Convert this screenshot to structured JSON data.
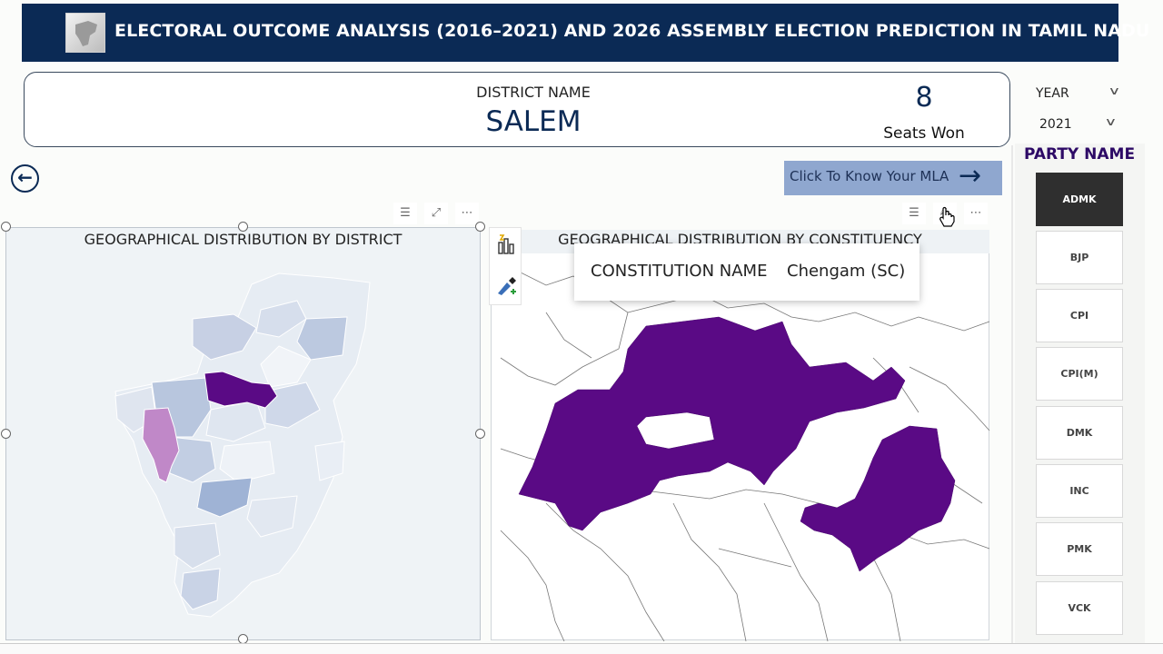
{
  "header": {
    "title": "ELECTORAL OUTCOME ANALYSIS (2016–2021) AND 2026 ASSEMBLY ELECTION PREDICTION IN TAMIL NADU"
  },
  "info_card": {
    "district_label": "DISTRICT NAME",
    "district_value": "SALEM",
    "seats_value": "8",
    "seats_label": "Seats Won"
  },
  "slicers": {
    "year_label": "YEAR",
    "year_value": "2021"
  },
  "party_panel": {
    "title": "PARTY NAME",
    "parties": [
      "ADMK",
      "BJP",
      "CPI",
      "CPI(M)",
      "DMK",
      "INC",
      "PMK",
      "VCK"
    ],
    "selected": "ADMK"
  },
  "mla_button": {
    "label": "Click To Know Your MLA"
  },
  "left_visual": {
    "title": "GEOGRAPHICAL DISTRIBUTION BY DISTRICT"
  },
  "right_visual": {
    "title": "GEOGRAPHICAL DISTRIBUTION BY CONSTITUENCY"
  },
  "tooltip": {
    "key": "CONSTITUTION NAME",
    "value": "Chengam (SC)"
  },
  "colors": {
    "header_bg": "#0b2a55",
    "highlight": "#5a0a85",
    "secondary_highlight": "#c088c8",
    "party_title": "#2d0a66",
    "selected_party_bg": "#2f2f2f",
    "mla_button_bg": "#8fa7cf"
  }
}
